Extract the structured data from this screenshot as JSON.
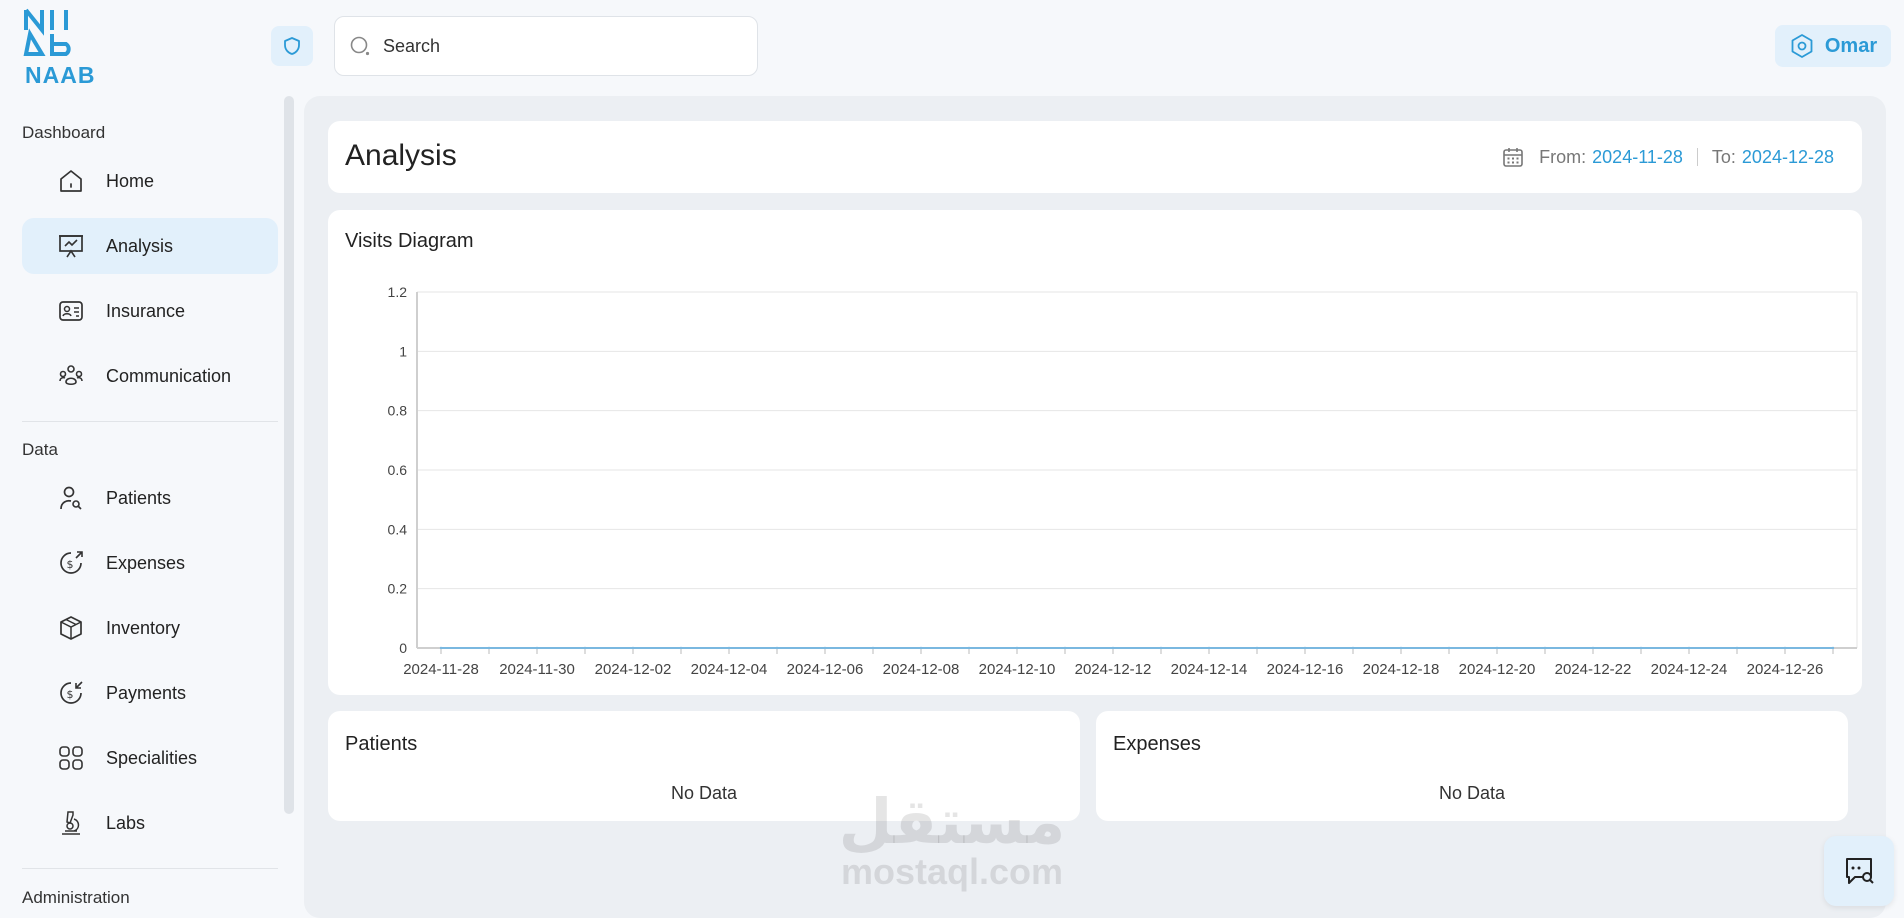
{
  "brand": {
    "name": "NAAB",
    "accent": "#2b9ad6"
  },
  "search": {
    "placeholder": "Search",
    "value": ""
  },
  "user": {
    "name": "Omar"
  },
  "sidebar": {
    "sections": {
      "dashboard": "Dashboard",
      "data": "Data",
      "administration": "Administration"
    },
    "items": [
      {
        "label": "Home",
        "icon": "home-icon",
        "active": false
      },
      {
        "label": "Analysis",
        "icon": "presentation-chart-icon",
        "active": true
      },
      {
        "label": "Insurance",
        "icon": "id-card-icon",
        "active": false
      },
      {
        "label": "Communication",
        "icon": "people-icon",
        "active": false
      },
      {
        "label": "Patients",
        "icon": "user-search-icon",
        "active": false
      },
      {
        "label": "Expenses",
        "icon": "money-out-icon",
        "active": false
      },
      {
        "label": "Inventory",
        "icon": "box-icon",
        "active": false
      },
      {
        "label": "Payments",
        "icon": "money-in-icon",
        "active": false
      },
      {
        "label": "Specialities",
        "icon": "grid-icon",
        "active": false
      },
      {
        "label": "Labs",
        "icon": "microscope-icon",
        "active": false
      }
    ]
  },
  "header": {
    "title": "Analysis",
    "from_label": "From:",
    "from_value": "2024-11-28",
    "to_label": "To:",
    "to_value": "2024-12-28"
  },
  "visits": {
    "title": "Visits Diagram"
  },
  "chart_data": {
    "type": "line",
    "title": "Visits Diagram",
    "ylim": [
      0,
      1.2
    ],
    "yticks": [
      "0",
      "0.2",
      "0.4",
      "0.6",
      "0.8",
      "1",
      "1.2"
    ],
    "x": [
      "2024-11-28",
      "2024-11-29",
      "2024-11-30",
      "2024-12-01",
      "2024-12-02",
      "2024-12-03",
      "2024-12-04",
      "2024-12-05",
      "2024-12-06",
      "2024-12-07",
      "2024-12-08",
      "2024-12-09",
      "2024-12-10",
      "2024-12-11",
      "2024-12-12",
      "2024-12-13",
      "2024-12-14",
      "2024-12-15",
      "2024-12-16",
      "2024-12-17",
      "2024-12-18",
      "2024-12-19",
      "2024-12-20",
      "2024-12-21",
      "2024-12-22",
      "2024-12-23",
      "2024-12-24",
      "2024-12-25",
      "2024-12-26",
      "2024-12-27"
    ],
    "xtick_labels": [
      "2024-11-28",
      "2024-11-30",
      "2024-12-02",
      "2024-12-04",
      "2024-12-06",
      "2024-12-08",
      "2024-12-10",
      "2024-12-12",
      "2024-12-14",
      "2024-12-16",
      "2024-12-18",
      "2024-12-20",
      "2024-12-22",
      "2024-12-24",
      "2024-12-26"
    ],
    "series": [
      {
        "values": [
          0,
          0,
          0,
          0,
          0,
          0,
          0,
          0,
          0,
          0,
          0,
          0,
          0,
          0,
          0,
          0,
          0,
          0,
          0,
          0,
          0,
          0,
          0,
          0,
          0,
          0,
          0,
          0,
          0,
          0
        ],
        "color": "#7ab8e0"
      }
    ],
    "grid": true
  },
  "patients": {
    "title": "Patients",
    "empty": "No Data"
  },
  "expenses": {
    "title": "Expenses",
    "empty": "No Data"
  },
  "watermark": {
    "arabic": "مستقل",
    "latin": "mostaql.com"
  }
}
